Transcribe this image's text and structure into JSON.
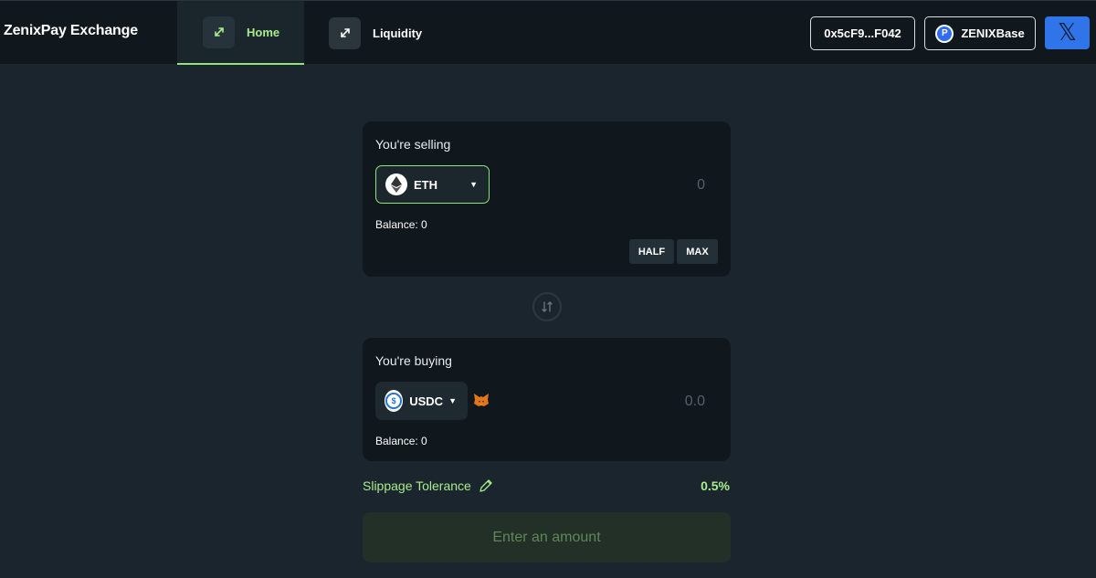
{
  "header": {
    "brand": "ZenixPay Exchange",
    "tabs": [
      {
        "label": "Home",
        "icon": "swap-arrows-icon",
        "active": true
      },
      {
        "label": "Liquidity",
        "icon": "swap-arrows-icon",
        "active": false
      }
    ],
    "wallet_address": "0x5cF9...F042",
    "network_label": "ZENIXBase",
    "network_logo_letter": "P",
    "x_button_label": "𝕏",
    "accent_color": "#a8ec8c"
  },
  "sell": {
    "title": "You're selling",
    "token": "ETH",
    "token_icon": "ethereum-icon",
    "amount_placeholder": "0",
    "balance": "Balance: 0",
    "half_label": "HALF",
    "max_label": "MAX"
  },
  "swap_toggle_icon": "swap-vertical-icon",
  "buy": {
    "title": "You're buying",
    "token": "USDC",
    "token_icon": "usdc-icon",
    "token_logo_text": "$",
    "wallet_icon": "metamask-fox-icon",
    "amount_placeholder": "0.0",
    "balance": "Balance: 0"
  },
  "slippage": {
    "label": "Slippage Tolerance",
    "value": "0.5%"
  },
  "submit_label": "Enter an amount"
}
